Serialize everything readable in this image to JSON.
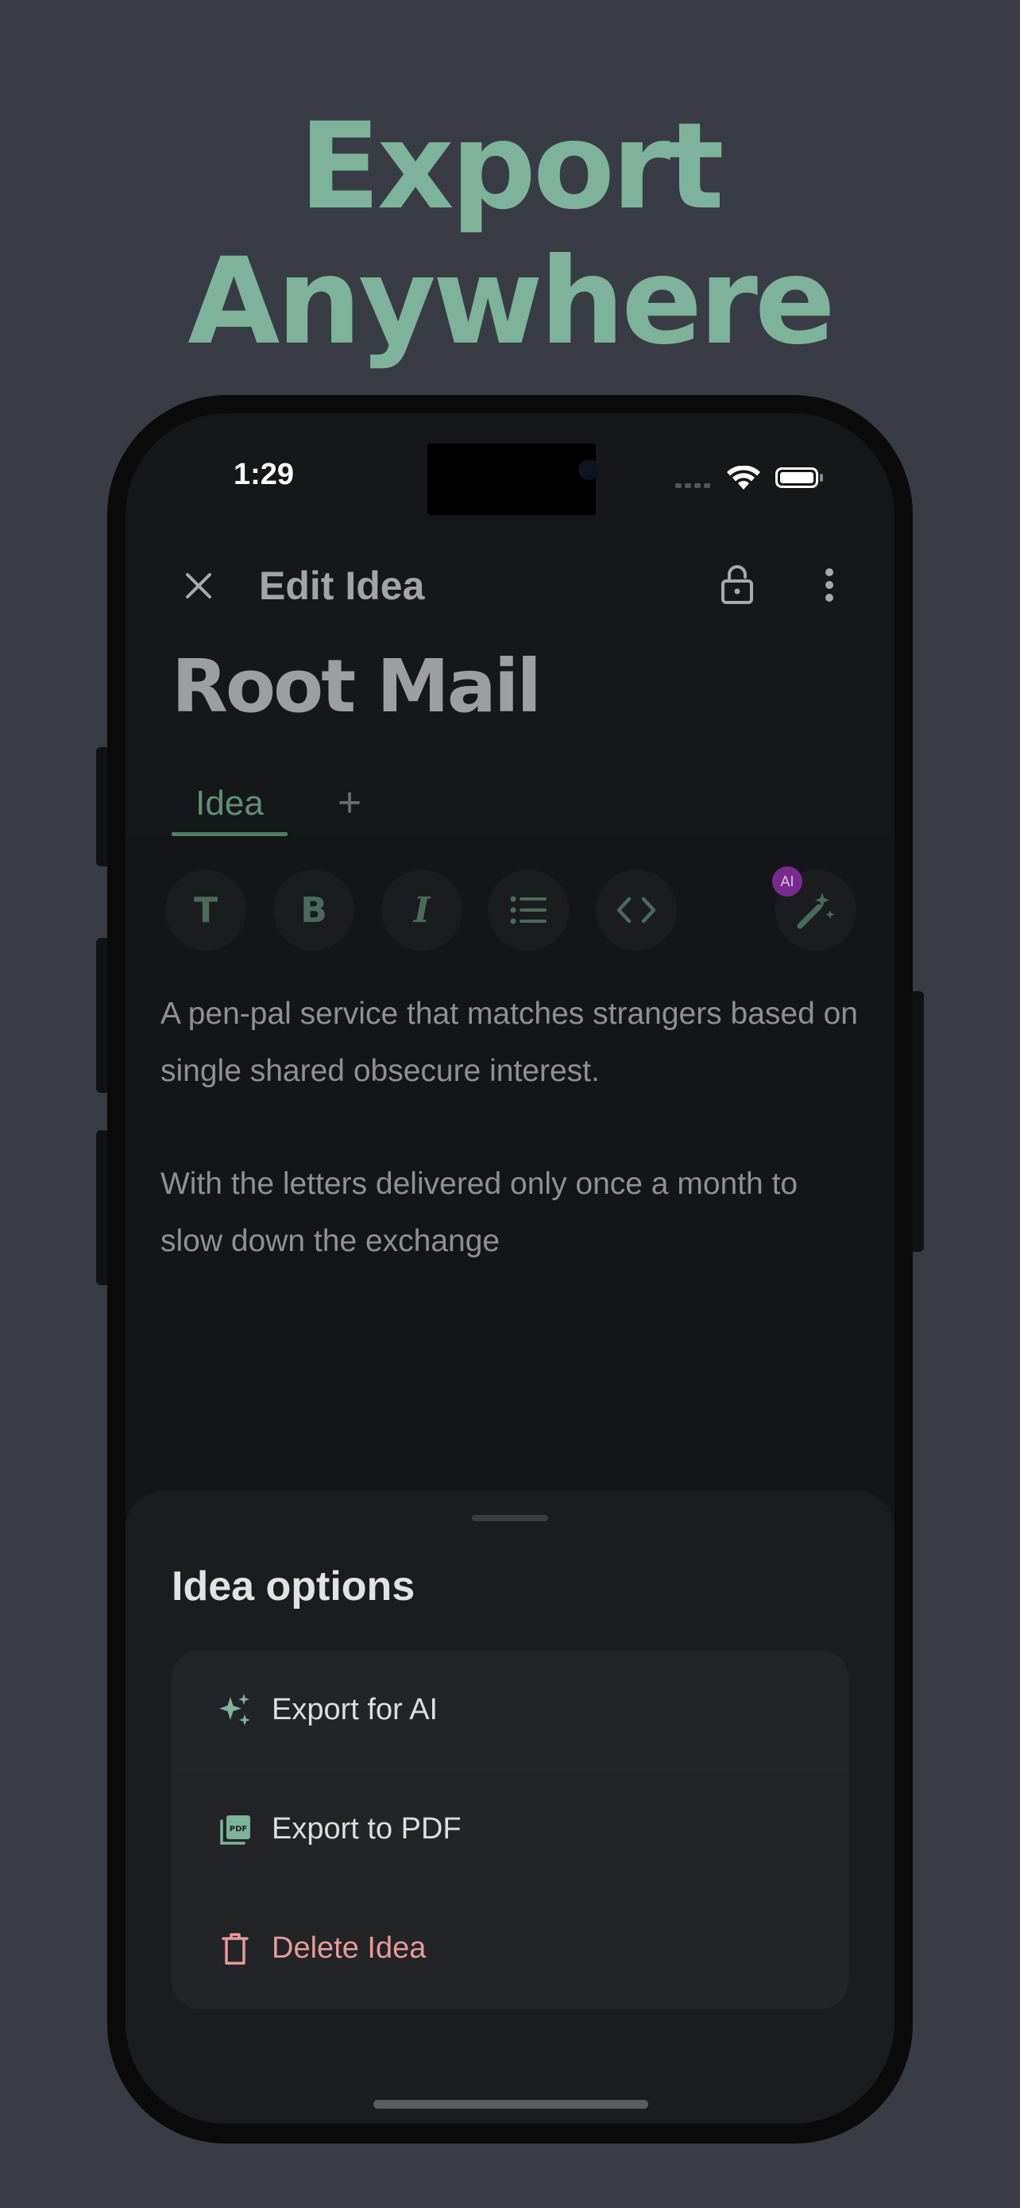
{
  "hero": {
    "line1": "Export",
    "line2": "Anywhere"
  },
  "colors": {
    "background": "#393c44",
    "accent": "#7db39a",
    "danger": "#e89a98",
    "ai_badge": "#7a2a8f"
  },
  "status_bar": {
    "time": "1:29",
    "icons": [
      "signal-icon",
      "wifi-icon",
      "battery-icon"
    ]
  },
  "app_bar": {
    "title": "Edit Idea",
    "icons": [
      "close-icon",
      "lock-open-icon",
      "more-vertical-icon"
    ]
  },
  "idea": {
    "title": "Root Mail",
    "tabs": [
      {
        "label": "Idea",
        "selected": true
      }
    ],
    "add_tab_label": "+",
    "paragraphs": [
      "A pen-pal service that matches strangers based on single shared obsecure interest.",
      "With the letters delivered only once a month to slow down the exchange"
    ]
  },
  "toolbar": {
    "buttons": [
      {
        "name": "text-style",
        "glyph": "T"
      },
      {
        "name": "bold",
        "glyph": "B"
      },
      {
        "name": "italic",
        "glyph": "I"
      },
      {
        "name": "list",
        "icon": "list-icon"
      },
      {
        "name": "code",
        "icon": "code-icon"
      },
      {
        "name": "ai-magic",
        "icon": "magic-wand-icon"
      }
    ],
    "ai_badge": "AI"
  },
  "sheet": {
    "title": "Idea options",
    "options": [
      {
        "label": "Export for AI",
        "icon": "sparkles-icon"
      },
      {
        "label": "Export to PDF",
        "icon": "pdf-icon"
      },
      {
        "label": "Delete Idea",
        "icon": "trash-icon",
        "danger": true
      }
    ]
  }
}
